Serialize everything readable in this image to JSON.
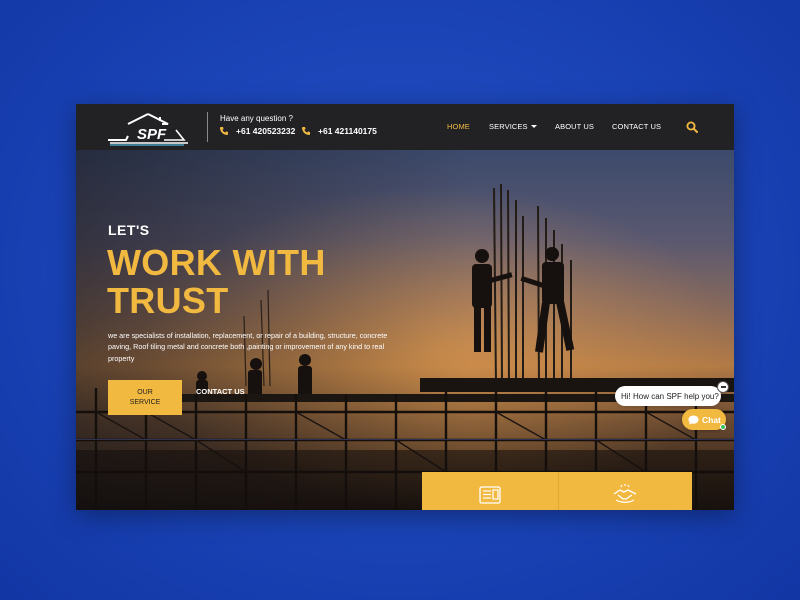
{
  "header": {
    "logo_text": "SPF",
    "question": "Have any question ?",
    "phones": [
      "+61 420523232",
      "+61 421140175"
    ],
    "nav": [
      {
        "label": "HOME",
        "active": true
      },
      {
        "label": "SERVICES",
        "active": false
      },
      {
        "label": "ABOUT US",
        "active": false
      },
      {
        "label": "CONTACT US",
        "active": false
      }
    ],
    "search_icon": "search-icon"
  },
  "hero": {
    "eyebrow": "LET'S",
    "headline_line1": "WORK WITH",
    "headline_line2": "TRUST",
    "description": "we are specialists of installation, replacement, or repair of a building, structure, concrete paving, Roof  tiling metal and concrete both ,painting or improvement of any kind to real property",
    "primary_button": "OUR SERVICE",
    "secondary_button": "CONTACT US"
  },
  "service_cards": [
    {
      "icon": "document-icon"
    },
    {
      "icon": "handshake-icon"
    }
  ],
  "chat": {
    "greeting": "Hi! How can SPF help you?",
    "button_label": "Chat"
  },
  "colors": {
    "accent": "#f2b941",
    "header_bg": "#222225",
    "page_bg": "#1a43b6"
  }
}
